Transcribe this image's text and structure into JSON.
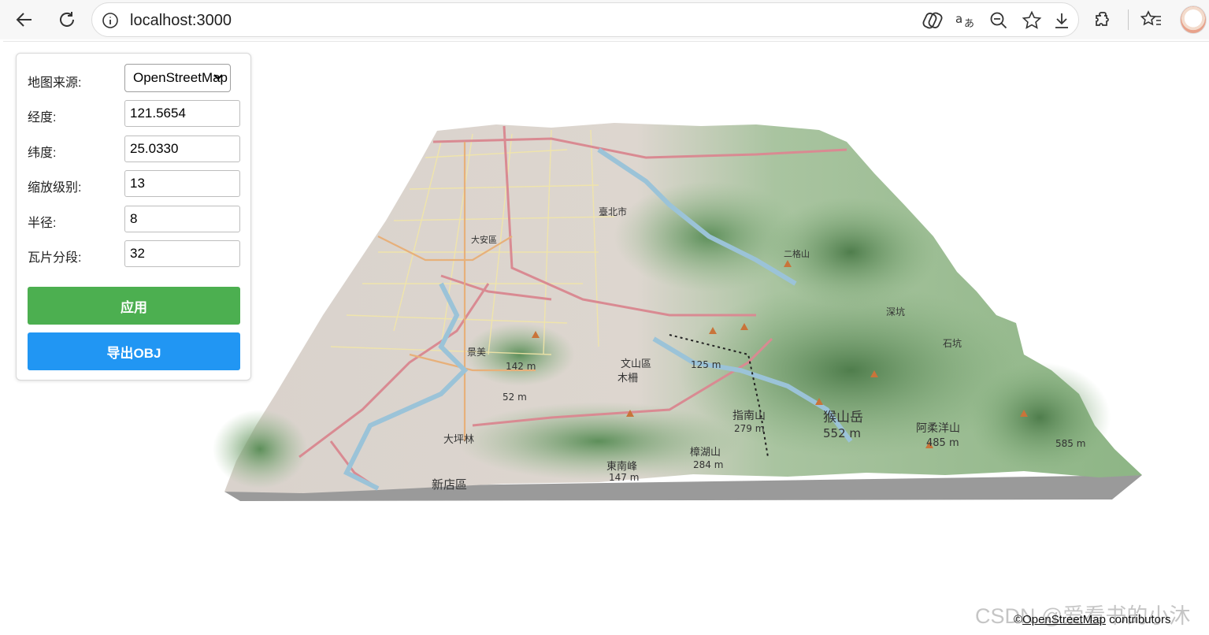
{
  "browser": {
    "url": "localhost:3000",
    "icons": [
      "back-icon",
      "reload-icon",
      "info-icon",
      "copilot-icon",
      "read-aloud-icon",
      "zoom-out-icon",
      "favorite-star-icon",
      "download-icon",
      "extensions-icon",
      "favorites-icon",
      "profile-avatar"
    ]
  },
  "panel": {
    "map_source": {
      "label": "地图来源:",
      "value": "OpenStreetMap"
    },
    "longitude": {
      "label": "经度:",
      "value": "121.5654"
    },
    "latitude": {
      "label": "纬度:",
      "value": "25.0330"
    },
    "zoom": {
      "label": "缩放级别:",
      "value": "13"
    },
    "radius": {
      "label": "半径:",
      "value": "8"
    },
    "segments": {
      "label": "瓦片分段:",
      "value": "32"
    },
    "apply_label": "应用",
    "export_label": "导出OBJ",
    "apply_color": "#4caf50",
    "export_color": "#2196f3"
  },
  "map": {
    "labels": [
      "臺北市",
      "大安區",
      "文山區",
      "木柵",
      "新店區",
      "大坪林",
      "指南山",
      "猴山岳",
      "阿柔洋山",
      "東南峰",
      "樟湖山",
      "二格山",
      "深坑",
      "石坑",
      "景美"
    ],
    "heights": [
      "552 m",
      "485 m",
      "284 m",
      "279 m",
      "147 m",
      "142 m",
      "125 m",
      "52 m",
      "585 m"
    ]
  },
  "attribution": {
    "prefix": "©",
    "link": "OpenStreetMap",
    "suffix": " contributors"
  },
  "watermark": "CSDN @爱看书的小沐"
}
